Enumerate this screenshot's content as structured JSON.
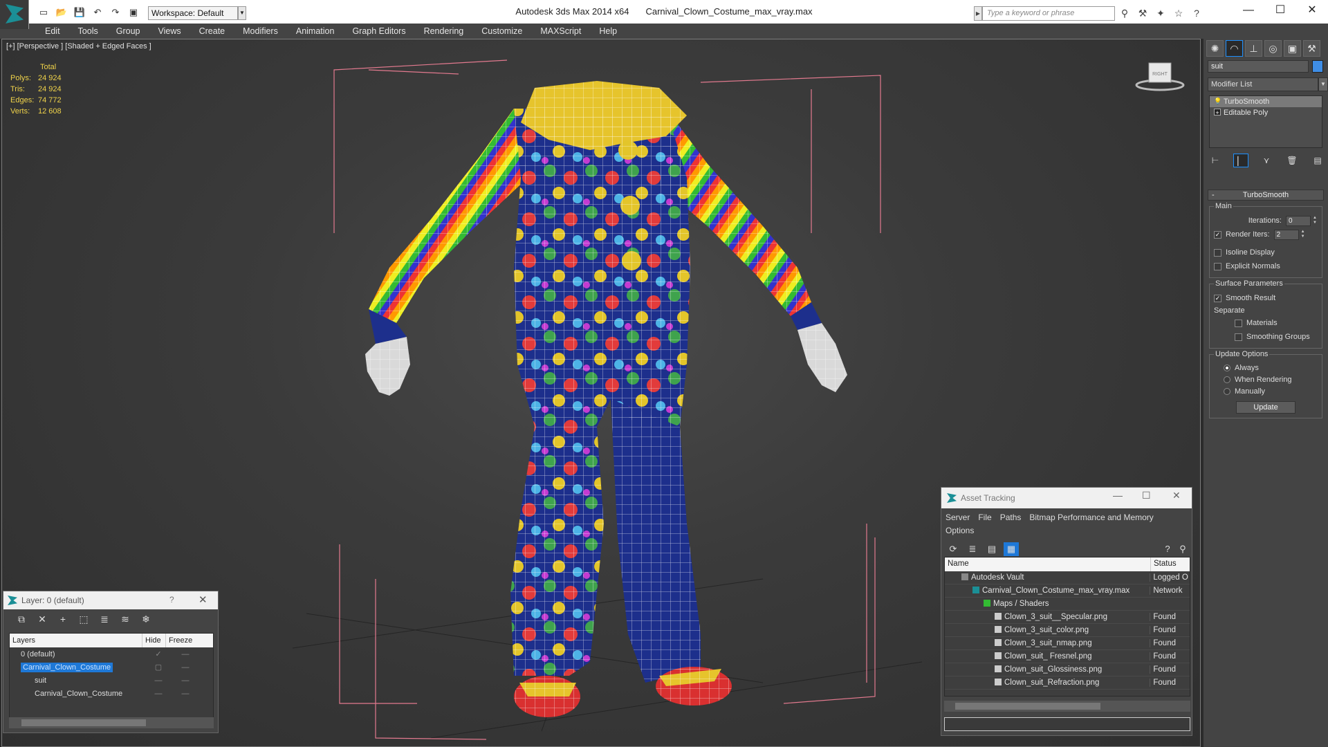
{
  "title_bar": {
    "app_name": "Autodesk 3ds Max  2014 x64",
    "file_name": "Carnival_Clown_Costume_max_vray.max",
    "workspace": "Workspace: Default",
    "search_placeholder": "Type a keyword or phrase"
  },
  "menu": [
    "Edit",
    "Tools",
    "Group",
    "Views",
    "Create",
    "Modifiers",
    "Animation",
    "Graph Editors",
    "Rendering",
    "Customize",
    "MAXScript",
    "Help"
  ],
  "viewport": {
    "label": "[+] [Perspective ] [Shaded + Edged Faces ]",
    "stats_header": "Total",
    "stats": [
      {
        "label": "Polys:",
        "value": "24 924"
      },
      {
        "label": "Tris:",
        "value": "24 924"
      },
      {
        "label": "Edges:",
        "value": "74 772"
      },
      {
        "label": "Verts:",
        "value": "12 608"
      }
    ],
    "viewcube_label": "RIGHT"
  },
  "command_panel": {
    "object_name": "suit",
    "object_color": "#3f8ee6",
    "modifier_list": "Modifier List",
    "stack": [
      "TurboSmooth",
      "Editable Poly"
    ],
    "rollout_title": "TurboSmooth",
    "main_group": "Main",
    "iterations_label": "Iterations:",
    "iterations_value": "0",
    "render_iters_label": "Render Iters:",
    "render_iters_value": "2",
    "isoline_label": "Isoline Display",
    "explicit_normals_label": "Explicit Normals",
    "surface_group": "Surface Parameters",
    "smooth_result_label": "Smooth Result",
    "separate_label": "Separate",
    "materials_label": "Materials",
    "smoothing_groups_label": "Smoothing Groups",
    "update_group": "Update Options",
    "always_label": "Always",
    "when_rendering_label": "When Rendering",
    "manually_label": "Manually",
    "update_button": "Update"
  },
  "layer_window": {
    "title": "Layer: 0 (default)",
    "help": "?",
    "col_layers": "Layers",
    "col_hide": "Hide",
    "col_freeze": "Freeze",
    "rows": [
      {
        "name": "0 (default)",
        "indent": 0
      },
      {
        "name": "Carnival_Clown_Costume",
        "indent": 0
      },
      {
        "name": "suit",
        "indent": 1
      },
      {
        "name": "Carnival_Clown_Costume",
        "indent": 1
      }
    ]
  },
  "asset_window": {
    "title": "Asset Tracking",
    "menu": [
      "Server",
      "File",
      "Paths",
      "Bitmap Performance and Memory",
      "Options"
    ],
    "col_name": "Name",
    "col_status": "Status",
    "rows": [
      {
        "name": "Autodesk Vault",
        "status": "Logged O",
        "indent": 1
      },
      {
        "name": "Carnival_Clown_Costume_max_vray.max",
        "status": "Network",
        "indent": 2
      },
      {
        "name": "Maps / Shaders",
        "status": "",
        "indent": 3
      },
      {
        "name": "Clown_3_suit__Specular.png",
        "status": "Found",
        "indent": 4
      },
      {
        "name": "Clown_3_suit_color.png",
        "status": "Found",
        "indent": 4
      },
      {
        "name": "Clown_3_suit_nmap.png",
        "status": "Found",
        "indent": 4
      },
      {
        "name": "Clown_suit_ Fresnel.png",
        "status": "Found",
        "indent": 4
      },
      {
        "name": "Clown_suit_Glossiness.png",
        "status": "Found",
        "indent": 4
      },
      {
        "name": "Clown_suit_Refraction.png",
        "status": "Found",
        "indent": 4
      }
    ]
  }
}
